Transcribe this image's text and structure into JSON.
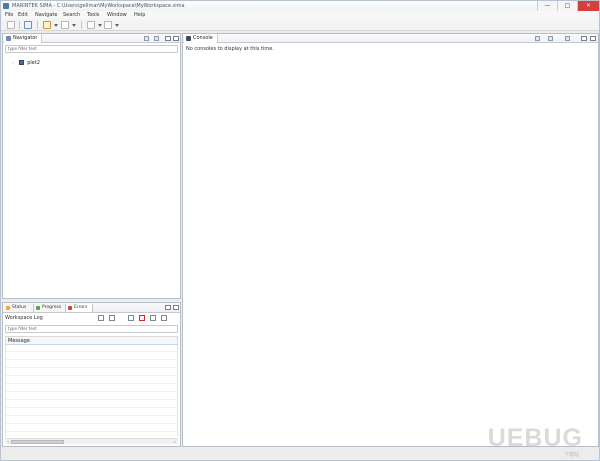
{
  "window": {
    "title": "MARINTEK SIMA - C:\\Users\\gellmar\\MyWorkspace\\MyWorkspace.sima",
    "controls": {
      "minimize": "—",
      "maximize": "□",
      "close": "×"
    }
  },
  "menu": [
    "File",
    "Edit",
    "Navigate",
    "Search",
    "Tools",
    "Window",
    "Help"
  ],
  "toolbar": {
    "icons": [
      "workspace-icon",
      "perspective-icon",
      "open-icon",
      "history-icon",
      "back-icon",
      "forward-icon"
    ]
  },
  "navigator": {
    "tab_label": "Navigator",
    "filter_placeholder": "type filter text",
    "tree_items": [
      {
        "label": "plet2",
        "icon": "project-icon"
      }
    ]
  },
  "console": {
    "tab_label": "Console",
    "message": "No consoles to display at this time."
  },
  "log_panel": {
    "tabs": [
      "Status",
      "Progress",
      "Errors"
    ],
    "title": "Workspace Log",
    "filter_placeholder": "type filter text",
    "column_header": "Message"
  },
  "watermark": {
    "brand": "UEBUG",
    "site": "下载站"
  },
  "colors": {
    "window_border": "#b9c3cf",
    "active_tab_accent": "#c7d6ea",
    "brand": "#4f79a4"
  }
}
